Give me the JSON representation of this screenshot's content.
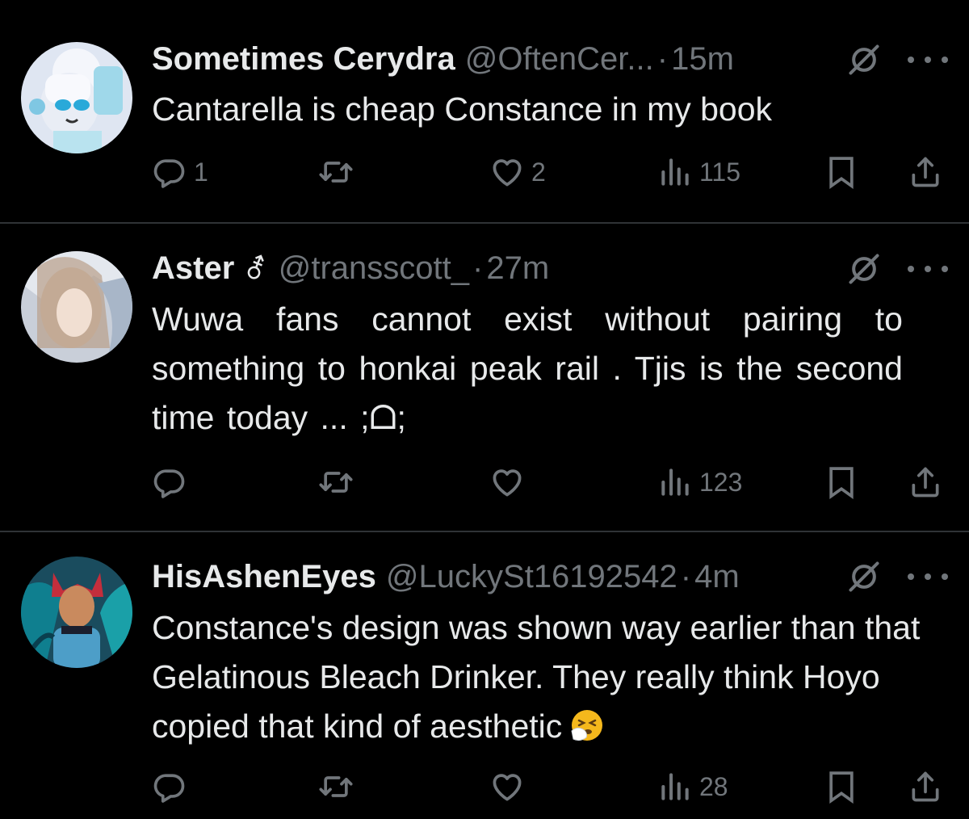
{
  "tweets": [
    {
      "display_name": "Sometimes Cerydra",
      "handle": "@OftenCer...",
      "dot": "·",
      "time": "15m",
      "text": "Cantarella is cheap Constance in my book",
      "replies": "1",
      "reposts": "",
      "likes": "2",
      "views": "115"
    },
    {
      "display_name": "Aster",
      "badge": "⚦",
      "handle": "@transscott_",
      "dot": "·",
      "time": "27m",
      "text": "Wuwa fans cannot exist without pairing to something to honkai peak rail . Tjis is the second time today ... ;ᗝ;",
      "replies": "",
      "reposts": "",
      "likes": "",
      "views": "123"
    },
    {
      "display_name": "HisAshenEyes",
      "handle": "@LuckySt16192542",
      "dot": "·",
      "time": "4m",
      "text": "Constance's design was shown way earlier than that Gelatinous Bleach Drinker. They really think Hoyo copied that kind of aesthetic",
      "replies": "",
      "reposts": "",
      "likes": "",
      "views": "28"
    }
  ],
  "icons": {
    "reply": "reply-icon",
    "repost": "repost-icon",
    "like": "heart-icon",
    "views": "views-icon",
    "bookmark": "bookmark-icon",
    "share": "share-icon",
    "grok": "grok-icon",
    "more": "more-icon",
    "emoji": "sneezing-face-emoji"
  },
  "colors": {
    "background": "#000000",
    "text": "#e7e9ea",
    "muted": "#71767b",
    "divider": "#2f3336"
  }
}
